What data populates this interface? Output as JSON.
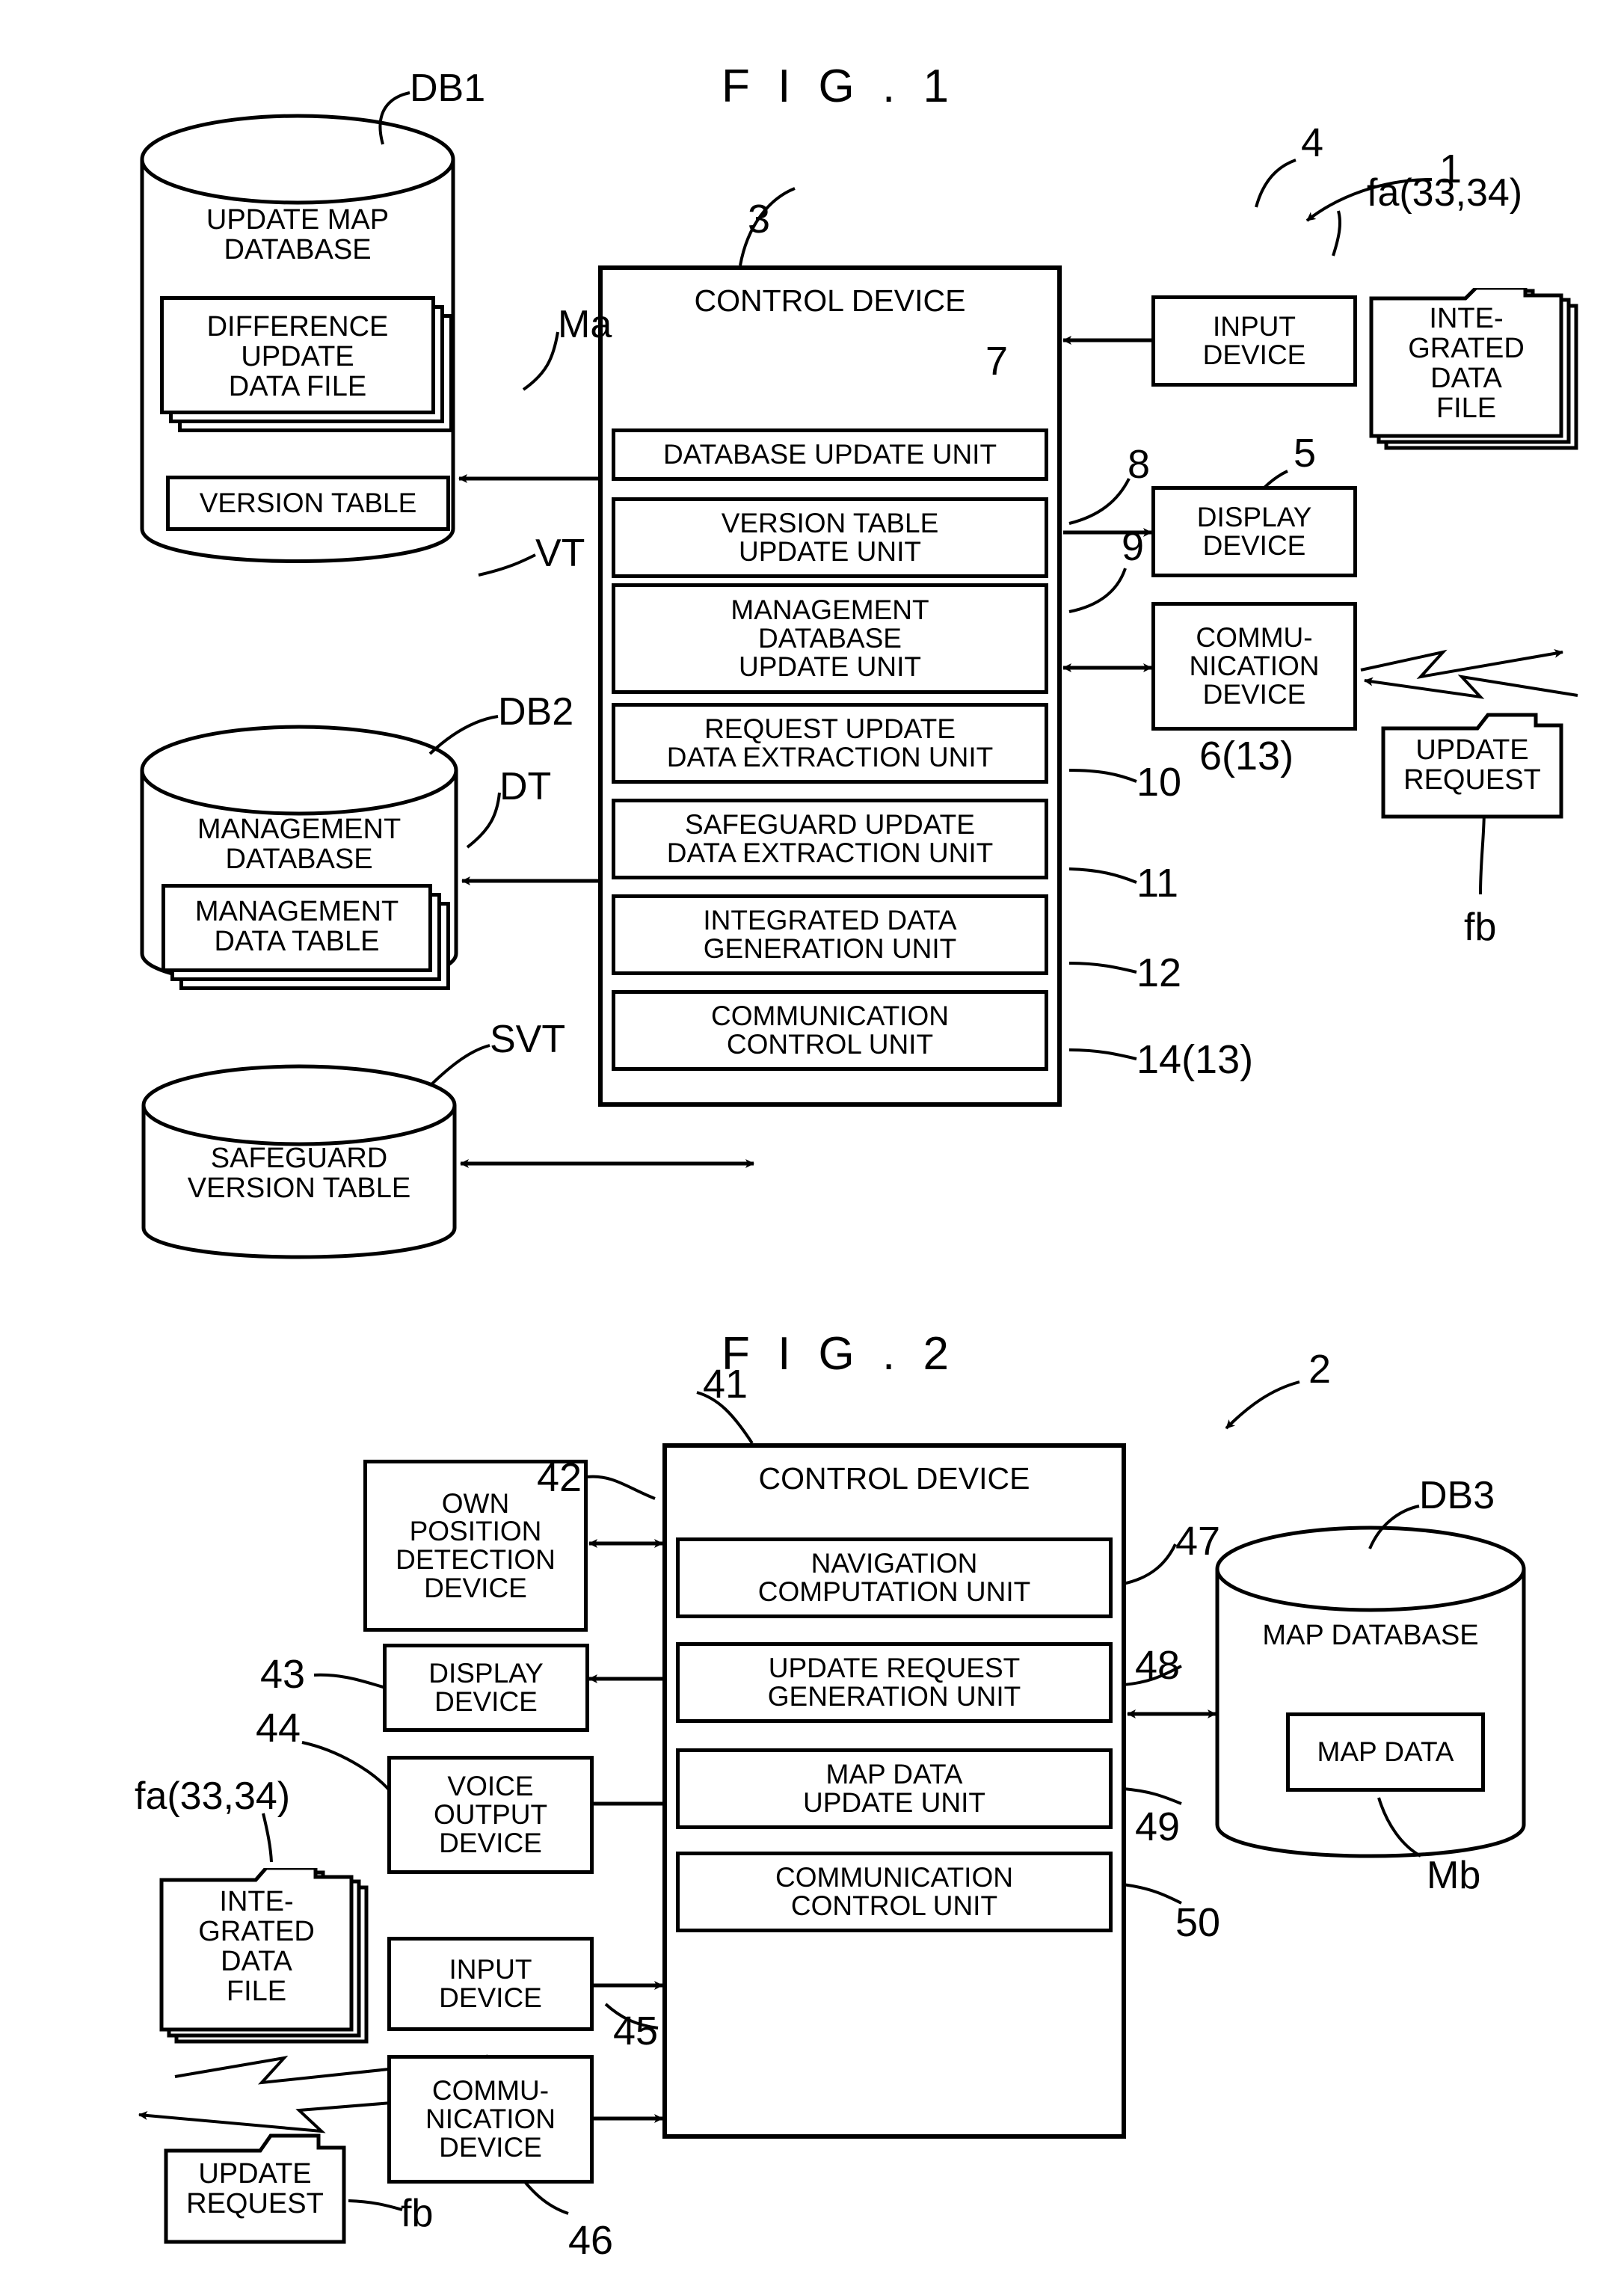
{
  "figures": [
    {
      "id": "fig1",
      "title": "F I G . 1",
      "system_ref": "1",
      "control_device": {
        "label": "CONTROL DEVICE",
        "ref": "3",
        "units": [
          {
            "label": "DATABASE UPDATE UNIT",
            "ref": "7"
          },
          {
            "label": "VERSION TABLE\nUPDATE UNIT",
            "ref": "8"
          },
          {
            "label": "MANAGEMENT\nDATABASE\nUPDATE UNIT",
            "ref": "9"
          },
          {
            "label": "REQUEST UPDATE\nDATA EXTRACTION UNIT",
            "ref": "10"
          },
          {
            "label": "SAFEGUARD UPDATE\nDATA EXTRACTION UNIT",
            "ref": "11"
          },
          {
            "label": "INTEGRATED DATA\nGENERATION UNIT",
            "ref": "12"
          },
          {
            "label": "COMMUNICATION\nCONTROL UNIT",
            "ref": "14(13)"
          }
        ]
      },
      "databases": [
        {
          "name": "UPDATE MAP\nDATABASE",
          "ref": "DB1",
          "inner": [
            {
              "label": "DIFFERENCE\nUPDATE\nDATA FILE",
              "ref": "Ma",
              "stacked": true
            },
            {
              "label": "VERSION TABLE",
              "ref": "VT",
              "stacked": false
            }
          ]
        },
        {
          "name": "MANAGEMENT\nDATABASE",
          "ref": "DB2",
          "inner": [
            {
              "label": "MANAGEMENT\nDATA TABLE",
              "ref": "DT",
              "stacked": true
            }
          ]
        },
        {
          "name": "SAFEGUARD\nVERSION TABLE",
          "ref": "SVT",
          "inner": []
        }
      ],
      "peripherals": [
        {
          "label": "INPUT\nDEVICE",
          "ref": "4"
        },
        {
          "label": "DISPLAY\nDEVICE",
          "ref": "5"
        },
        {
          "label": "COMMU-\nNICATION\nDEVICE",
          "ref": "6(13)"
        }
      ],
      "files": [
        {
          "label": "INTE-\nGRATED\nDATA\nFILE",
          "ref": "fa(33,34)",
          "stacked": true
        },
        {
          "label": "UPDATE\nREQUEST",
          "ref": "fb",
          "stacked": false
        }
      ]
    },
    {
      "id": "fig2",
      "title": "F I G . 2",
      "system_ref": "2",
      "control_device": {
        "label": "CONTROL DEVICE",
        "ref": "41",
        "units": [
          {
            "label": "NAVIGATION\nCOMPUTATION UNIT",
            "ref": "47"
          },
          {
            "label": "UPDATE REQUEST\nGENERATION UNIT",
            "ref": "48"
          },
          {
            "label": "MAP DATA\nUPDATE UNIT",
            "ref": "49"
          },
          {
            "label": "COMMUNICATION\nCONTROL UNIT",
            "ref": "50"
          }
        ]
      },
      "databases": [
        {
          "name": "MAP DATABASE",
          "ref": "DB3",
          "inner": [
            {
              "label": "MAP DATA",
              "ref": "Mb",
              "stacked": false
            }
          ]
        }
      ],
      "peripherals": [
        {
          "label": "OWN\nPOSITION\nDETECTION\nDEVICE",
          "ref": "42"
        },
        {
          "label": "DISPLAY\nDEVICE",
          "ref": "43"
        },
        {
          "label": "VOICE\nOUTPUT\nDEVICE",
          "ref": "44"
        },
        {
          "label": "INPUT\nDEVICE",
          "ref": "45"
        },
        {
          "label": "COMMU-\nNICATION\nDEVICE",
          "ref": "46"
        }
      ],
      "files": [
        {
          "label": "INTE-\nGRATED\nDATA\nFILE",
          "ref": "fa(33,34)",
          "stacked": true
        },
        {
          "label": "UPDATE\nREQUEST",
          "ref": "fb",
          "stacked": false
        }
      ]
    }
  ],
  "fig1": {
    "title": "F I G . 1",
    "ref_system": "1",
    "ref_control": "3",
    "control_label": "CONTROL DEVICE",
    "u1": "DATABASE UPDATE UNIT",
    "u1_ref": "7",
    "u2_l1": "VERSION TABLE",
    "u2_l2": "UPDATE UNIT",
    "u2_ref": "8",
    "u3_l1": "MANAGEMENT",
    "u3_l2": "DATABASE",
    "u3_l3": "UPDATE UNIT",
    "u3_ref": "9",
    "u4_l1": "REQUEST UPDATE",
    "u4_l2": "DATA EXTRACTION UNIT",
    "u4_ref": "10",
    "u5_l1": "SAFEGUARD UPDATE",
    "u5_l2": "DATA EXTRACTION UNIT",
    "u5_ref": "11",
    "u6_l1": "INTEGRATED DATA",
    "u6_l2": "GENERATION UNIT",
    "u6_ref": "12",
    "u7_l1": "COMMUNICATION",
    "u7_l2": "CONTROL UNIT",
    "u7_ref": "14(13)",
    "db1_l1": "UPDATE MAP",
    "db1_l2": "DATABASE",
    "db1_ref": "DB1",
    "dif_l1": "DIFFERENCE",
    "dif_l2": "UPDATE",
    "dif_l3": "DATA FILE",
    "dif_ref": "Ma",
    "vt_label": "VERSION TABLE",
    "vt_ref": "VT",
    "db2_l1": "MANAGEMENT",
    "db2_l2": "DATABASE",
    "db2_ref": "DB2",
    "mdt_l1": "MANAGEMENT",
    "mdt_l2": "DATA TABLE",
    "mdt_ref": "DT",
    "svt_l1": "SAFEGUARD",
    "svt_l2": "VERSION TABLE",
    "svt_ref": "SVT",
    "input_l1": "INPUT",
    "input_l2": "DEVICE",
    "input_ref": "4",
    "display_l1": "DISPLAY",
    "display_l2": "DEVICE",
    "display_ref": "5",
    "comm_l1": "COMMU-",
    "comm_l2": "NICATION",
    "comm_l3": "DEVICE",
    "comm_ref": "6(13)",
    "idf_l1": "INTE-",
    "idf_l2": "GRATED",
    "idf_l3": "DATA",
    "idf_l4": "FILE",
    "idf_ref": "fa(33,34)",
    "ureq_l1": "UPDATE",
    "ureq_l2": "REQUEST",
    "ureq_ref": "fb"
  },
  "fig2": {
    "title": "F I G . 2",
    "ref_system": "2",
    "ref_control": "41",
    "control_label": "CONTROL DEVICE",
    "u1_l1": "NAVIGATION",
    "u1_l2": "COMPUTATION UNIT",
    "u1_ref": "47",
    "u2_l1": "UPDATE REQUEST",
    "u2_l2": "GENERATION UNIT",
    "u2_ref": "48",
    "u3_l1": "MAP DATA",
    "u3_l2": "UPDATE UNIT",
    "u3_ref": "49",
    "u4_l1": "COMMUNICATION",
    "u4_l2": "CONTROL UNIT",
    "u4_ref": "50",
    "own_l1": "OWN",
    "own_l2": "POSITION",
    "own_l3": "DETECTION",
    "own_l4": "DEVICE",
    "own_ref": "42",
    "display_l1": "DISPLAY",
    "display_l2": "DEVICE",
    "display_ref": "43",
    "voice_l1": "VOICE",
    "voice_l2": "OUTPUT",
    "voice_l3": "DEVICE",
    "voice_ref": "44",
    "input_l1": "INPUT",
    "input_l2": "DEVICE",
    "input_ref": "45",
    "comm_l1": "COMMU-",
    "comm_l2": "NICATION",
    "comm_l3": "DEVICE",
    "comm_ref": "46",
    "idf_l1": "INTE-",
    "idf_l2": "GRATED",
    "idf_l3": "DATA",
    "idf_l4": "FILE",
    "idf_ref": "fa(33,34)",
    "ureq_l1": "UPDATE",
    "ureq_l2": "REQUEST",
    "ureq_ref": "fb",
    "db3_label": "MAP DATABASE",
    "db3_ref": "DB3",
    "mapdata_label": "MAP DATA",
    "mapdata_ref": "Mb"
  },
  "colors": {
    "ink": "#000000",
    "paper": "#ffffff"
  }
}
